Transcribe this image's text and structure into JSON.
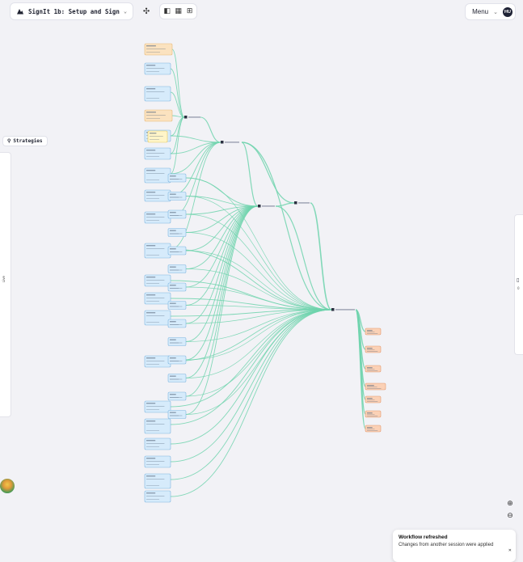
{
  "toolbar": {
    "workflow_title": "SignIt 1b: Setup and Sign",
    "menu_label": "Menu",
    "avatar_initials": "HU"
  },
  "strategies": {
    "label": "Strategies"
  },
  "left_panel": {
    "label": "Live"
  },
  "right_panel": {
    "label": "0"
  },
  "toast": {
    "title": "Workflow refreshed",
    "message": "Changes from another session were applied"
  },
  "colors": {
    "edge": "#6fd3ad",
    "input_node": "#d6ebfb",
    "input_border": "#7fb6e0",
    "config_node": "#fbe2bf",
    "config_border": "#e8b977",
    "output_node": "#fbd1b6",
    "output_border": "#e39a6f",
    "background": "#f2f2f6"
  },
  "icons": [
    "logo-icon",
    "sparkle-icon",
    "layout-icon",
    "grid-icon",
    "apps-icon",
    "chevron-down-icon",
    "strategy-icon",
    "clipboard-icon",
    "zoom-in-icon",
    "zoom-out-icon",
    "close-icon"
  ]
}
